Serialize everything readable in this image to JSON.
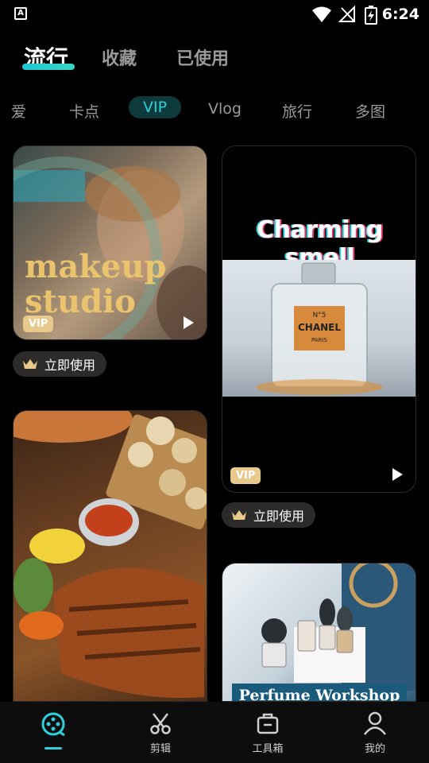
{
  "status_bar": {
    "time": "6:24",
    "app_icon_letter": "A"
  },
  "top_tabs": [
    {
      "label": "流行",
      "active": true
    },
    {
      "label": "收藏",
      "active": false
    },
    {
      "label": "已使用",
      "active": false
    }
  ],
  "categories": [
    {
      "label": "爱",
      "active": false
    },
    {
      "label": "卡点",
      "active": false
    },
    {
      "label": "VIP",
      "active": true
    },
    {
      "label": "Vlog",
      "active": false
    },
    {
      "label": "旅行",
      "active": false
    },
    {
      "label": "多图",
      "active": false
    }
  ],
  "templates": {
    "makeup": {
      "title_line1": "makeup",
      "title_line2": "studio",
      "badge": "VIP"
    },
    "charming": {
      "title": "Charming smell",
      "bottle_brand": "CHANEL",
      "bottle_no": "N°5",
      "bottle_city": "PARIS",
      "badge": "VIP"
    },
    "food": {},
    "perfume": {
      "title": "Perfume Workshop"
    }
  },
  "use_button_label": "立即使用",
  "bottom_nav": [
    {
      "label": "",
      "icon": "film-reel-icon",
      "active": true
    },
    {
      "label": "剪辑",
      "icon": "scissors-icon",
      "active": false
    },
    {
      "label": "工具箱",
      "icon": "toolbox-icon",
      "active": false
    },
    {
      "label": "我的",
      "icon": "user-icon",
      "active": false
    }
  ],
  "colors": {
    "accent": "#2dd0dc",
    "vip_gold": "#e8c98b",
    "background": "#000000"
  }
}
